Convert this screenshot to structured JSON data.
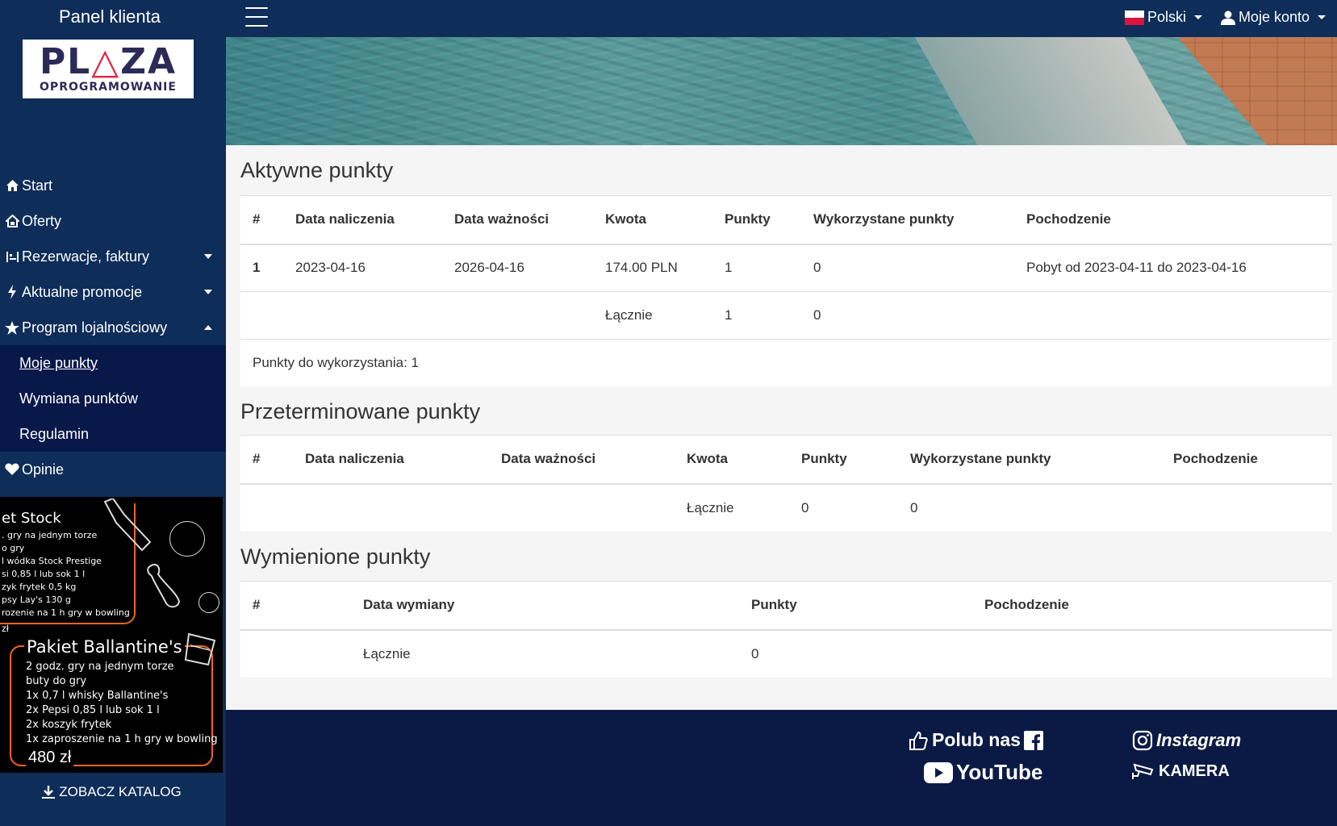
{
  "sidebar": {
    "title": "Panel klienta",
    "logo": {
      "main_a": "PL",
      "main_b": "ZA",
      "sub": "OPROGRAMOWANIE"
    },
    "items": [
      {
        "label": "Start",
        "icon": "home-icon"
      },
      {
        "label": "Oferty",
        "icon": "offers-icon"
      },
      {
        "label": "Rezerwacje, faktury",
        "icon": "reservations-icon"
      },
      {
        "label": "Aktualne promocje",
        "icon": "bolt-icon"
      },
      {
        "label": "Program lojalnościowy",
        "icon": "star-icon"
      }
    ],
    "subitems": [
      {
        "label": "Moje punkty"
      },
      {
        "label": "Wymiana punktów"
      },
      {
        "label": "Regulamin"
      }
    ],
    "opinions": {
      "label": "Opinie",
      "icon": "heart-icon"
    },
    "catalog_label": "ZOBACZ KATALOG"
  },
  "promo": {
    "title1": "et Stock",
    "lines1": [
      ". gry na jednym torze",
      "o gry",
      "l wódka Stock Prestige",
      "si 0,85 l lub sok 1 l",
      "zyk frytek 0,5 kg",
      "psy Lay's 130 g",
      "rozenie na 1 h gry w bowling"
    ],
    "price1": "zł",
    "title2": "Pakiet Ballantine's",
    "lines2": [
      "2 godz. gry na jednym torze",
      "buty do gry",
      "1x 0,7 l whisky Ballantine's",
      "2x Pepsi 0,85 l lub sok 1 l",
      "2x koszyk frytek",
      "1x zaproszenie na 1 h gry w bowling"
    ],
    "price2": "480 zł"
  },
  "topbar": {
    "language": "Polski",
    "account": "Moje konto"
  },
  "active": {
    "title": "Aktywne punkty",
    "headers": [
      "#",
      "Data naliczenia",
      "Data ważności",
      "Kwota",
      "Punkty",
      "Wykorzystane punkty",
      "Pochodzenie"
    ],
    "rows": [
      [
        "1",
        "2023-04-16",
        "2026-04-16",
        "174.00 PLN",
        "1",
        "0",
        "Pobyt od 2023-04-11 do 2023-04-16"
      ]
    ],
    "total": {
      "label": "Łącznie",
      "points": "1",
      "used": "0"
    },
    "available": "Punkty do wykorzystania: 1"
  },
  "expired": {
    "title": "Przeterminowane punkty",
    "headers": [
      "#",
      "Data naliczenia",
      "Data ważności",
      "Kwota",
      "Punkty",
      "Wykorzystane punkty",
      "Pochodzenie"
    ],
    "total": {
      "label": "Łącznie",
      "points": "0",
      "used": "0"
    }
  },
  "exchanged": {
    "title": "Wymienione punkty",
    "headers": [
      "#",
      "Data wymiany",
      "Punkty",
      "Pochodzenie"
    ],
    "total": {
      "label": "Łącznie",
      "points": "0"
    }
  },
  "footer": {
    "like": "Polub nas",
    "youtube": "YouTube",
    "instagram": "Instagram",
    "camera": "KAMERA"
  }
}
